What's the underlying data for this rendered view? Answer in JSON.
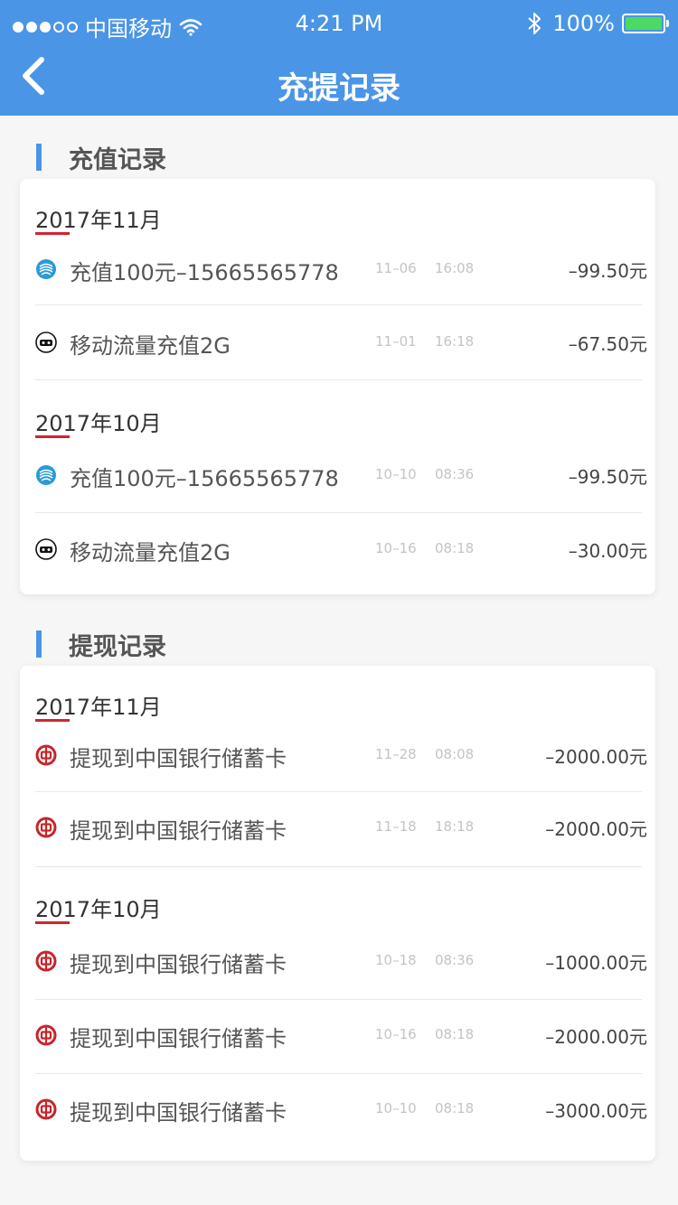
{
  "status_bar": {
    "carrier": "中国移动",
    "time": "4:21 PM",
    "battery": "100%"
  },
  "nav": {
    "title": "充提记录"
  },
  "recharge": {
    "title": "充值记录",
    "groups": [
      {
        "month": "2017年11月",
        "items": [
          {
            "label": "充值100元–15665565778",
            "date": "11–06",
            "time": "16:08",
            "amount": "–99.50元",
            "icon": "china-mobile-icon"
          },
          {
            "label": "移动流量充值2G",
            "date": "11–01",
            "time": "16:18",
            "amount": "–67.50元",
            "icon": "tmall-icon"
          }
        ]
      },
      {
        "month": "2017年10月",
        "items": [
          {
            "label": "充值100元–15665565778",
            "date": "10–10",
            "time": "08:36",
            "amount": "–99.50元",
            "icon": "china-mobile-icon"
          },
          {
            "label": "移动流量充值2G",
            "date": "10–16",
            "time": "08:18",
            "amount": "–30.00元",
            "icon": "tmall-icon"
          }
        ]
      }
    ]
  },
  "withdraw": {
    "title": "提现记录",
    "groups": [
      {
        "month": "2017年11月",
        "items": [
          {
            "label": "提现到中国银行储蓄卡",
            "date": "11–28",
            "time": "08:08",
            "amount": "–2000.00元",
            "icon": "bank-of-china-icon"
          },
          {
            "label": "提现到中国银行储蓄卡",
            "date": "11–18",
            "time": "18:18",
            "amount": "–2000.00元",
            "icon": "bank-of-china-icon"
          }
        ]
      },
      {
        "month": "2017年10月",
        "items": [
          {
            "label": "提现到中国银行储蓄卡",
            "date": "10–18",
            "time": "08:36",
            "amount": "–1000.00元",
            "icon": "bank-of-china-icon"
          },
          {
            "label": "提现到中国银行储蓄卡",
            "date": "10–16",
            "time": "08:18",
            "amount": "–2000.00元",
            "icon": "bank-of-china-icon"
          },
          {
            "label": "提现到中国银行储蓄卡",
            "date": "10–10",
            "time": "08:18",
            "amount": "–3000.00元",
            "icon": "bank-of-china-icon"
          }
        ]
      }
    ]
  },
  "colors": {
    "primary": "#4a95e6",
    "accent_red": "#d0252e",
    "battery_green": "#4cd964"
  }
}
